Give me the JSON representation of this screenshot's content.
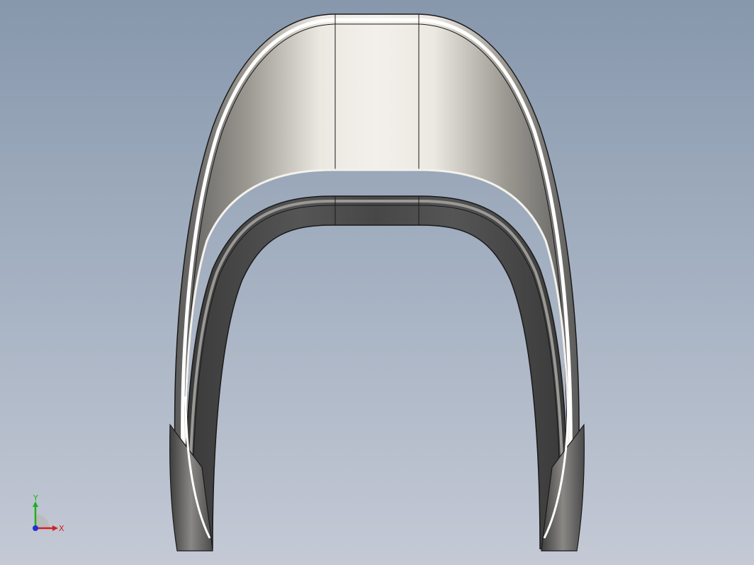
{
  "viewport": {
    "background_top": "#8797ac",
    "background_bottom": "#c4c9d5"
  },
  "model": {
    "description_icon": "cad-model-u-shaped-part",
    "edge_color": "#1a1a1a",
    "highlight_color": "#f2eee8",
    "shadow_color": "#3e3e3e"
  },
  "triad": {
    "x_label": "X",
    "y_label": "Y",
    "x_color": "#d42020",
    "y_color": "#20b020",
    "z_color": "#2030d0"
  }
}
